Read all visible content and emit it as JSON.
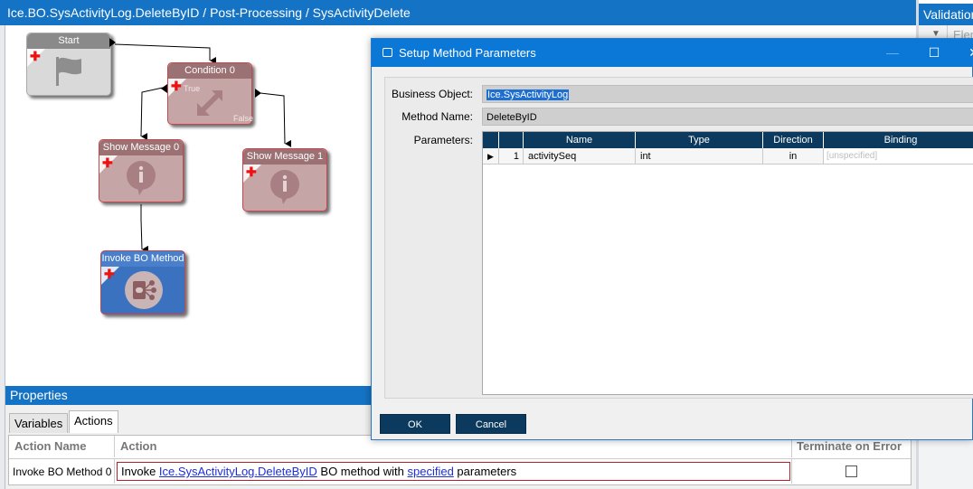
{
  "window": {
    "title": "Ice.BO.SysActivityLog.DeleteByID / Post-Processing / SysActivityDelete"
  },
  "validation_panel": {
    "title": "Validation",
    "column_label": "Elem"
  },
  "workflow": {
    "nodes": {
      "start": {
        "label": "Start"
      },
      "condition": {
        "label": "Condition 0",
        "true_label": "True",
        "false_label": "False"
      },
      "show_message_0": {
        "label": "Show Message 0"
      },
      "show_message_1": {
        "label": "Show Message 1"
      },
      "invoke_bo_method": {
        "label": "Invoke BO Method"
      }
    }
  },
  "properties": {
    "title": "Properties",
    "tabs": [
      "Variables",
      "Actions"
    ],
    "active_tab": "Actions",
    "columns": [
      "Action Name",
      "Action",
      "Terminate on Error"
    ],
    "rows": [
      {
        "action_name": "Invoke BO Method 0",
        "action_prefix": "Invoke ",
        "action_link": "Ice.SysActivityLog.DeleteByID",
        "action_middle": " BO method with ",
        "action_link2": "specified",
        "action_suffix": " parameters",
        "terminate_on_error": false
      }
    ]
  },
  "dialog": {
    "title": "Setup Method Parameters",
    "fields": {
      "business_object_label": "Business Object:",
      "business_object_value": "Ice.SysActivityLog",
      "method_name_label": "Method Name:",
      "method_name_value": "DeleteByID",
      "parameters_label": "Parameters:"
    },
    "param_columns": [
      "Name",
      "Type",
      "Direction",
      "Binding"
    ],
    "params": [
      {
        "row_marker": "▶",
        "index": "1",
        "name": "activitySeq",
        "type": "int",
        "direction": "in",
        "binding": "[unspecified]"
      }
    ],
    "buttons": {
      "ok": "OK",
      "cancel": "Cancel"
    },
    "window_buttons": {
      "minimize": "—",
      "maximize": "☐",
      "close": "✕"
    }
  },
  "colors": {
    "accent_blue": "#1473c4",
    "dialog_title": "#0b78d7",
    "grid_header": "#0c3a5e",
    "node_pink": "#c5a5a6",
    "node_border_red": "#c9454c"
  }
}
